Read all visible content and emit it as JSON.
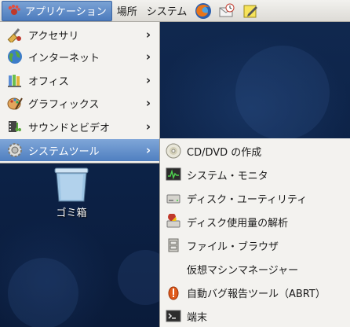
{
  "panel": {
    "applications_label": "アプリケーション",
    "places_label": "場所",
    "system_label": "システム"
  },
  "menu": {
    "items": [
      {
        "label": "アクセサリ",
        "icon": "accessories-icon"
      },
      {
        "label": "インターネット",
        "icon": "internet-globe-icon"
      },
      {
        "label": "オフィス",
        "icon": "office-icon"
      },
      {
        "label": "グラフィックス",
        "icon": "graphics-icon"
      },
      {
        "label": "サウンドとビデオ",
        "icon": "sound-video-icon"
      },
      {
        "label": "システムツール",
        "icon": "system-tools-gear-icon",
        "selected": true
      }
    ],
    "arrow": "›"
  },
  "submenu": {
    "items": [
      {
        "label": "CD/DVD の作成",
        "icon": "cd-dvd-icon"
      },
      {
        "label": "システム・モニタ",
        "icon": "system-monitor-icon"
      },
      {
        "label": "ディスク・ユーティリティ",
        "icon": "disk-utility-icon"
      },
      {
        "label": "ディスク使用量の解析",
        "icon": "disk-usage-icon"
      },
      {
        "label": "ファイル・ブラウザ",
        "icon": "file-browser-icon"
      },
      {
        "label": "仮想マシンマネージャー",
        "icon": ""
      },
      {
        "label": "自動バグ報告ツール（ABRT）",
        "icon": "abrt-alert-icon"
      },
      {
        "label": "端末",
        "icon": "terminal-icon"
      }
    ]
  },
  "desktop": {
    "trash_label": "ゴミ箱"
  },
  "colors": {
    "panel_bg": "#e8e6e1",
    "selection": "#5b88c6",
    "menu_bg": "#f3f2ef",
    "desktop_bg": "#0c2145"
  }
}
